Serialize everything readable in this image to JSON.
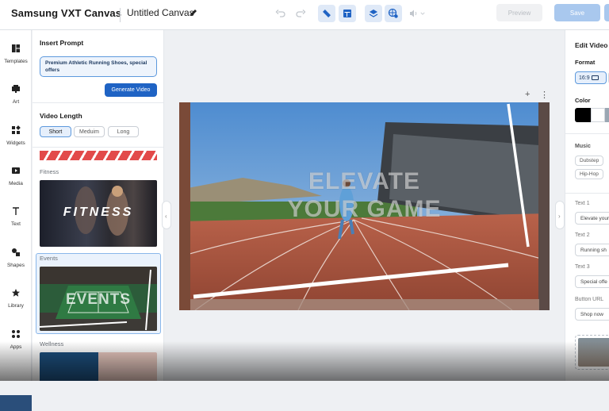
{
  "header": {
    "app_title": "Samsung VXT Canvas",
    "doc_title": "Untitled Canvas",
    "preview_label": "Preview",
    "save_label": "Save"
  },
  "rail": {
    "items": [
      {
        "label": "Templates",
        "icon": "templates-icon"
      },
      {
        "label": "Art",
        "icon": "art-icon"
      },
      {
        "label": "Widgets",
        "icon": "widgets-icon"
      },
      {
        "label": "Media",
        "icon": "media-icon"
      },
      {
        "label": "Text",
        "icon": "text-icon"
      },
      {
        "label": "Shapes",
        "icon": "shapes-icon"
      },
      {
        "label": "Library",
        "icon": "library-icon"
      },
      {
        "label": "Apps",
        "icon": "apps-icon"
      }
    ]
  },
  "panel": {
    "insert_prompt_heading": "Insert Prompt",
    "prompt_text": "Premium Athletic Running Shoes, special offers",
    "generate_label": "Generate Video",
    "video_length_heading": "Video Length",
    "length_options": [
      "Short",
      "Meduim",
      "Long"
    ],
    "selected_length": "Short",
    "categories": [
      {
        "label": "Fitness",
        "thumb_text": "FITNESS"
      },
      {
        "label": "Events",
        "thumb_text": "EVENTS"
      },
      {
        "label": "Wellness",
        "thumb_text": ""
      }
    ]
  },
  "canvas": {
    "overlay_line1": "ELEVATE",
    "overlay_line2": "YOUR GAME"
  },
  "right_panel": {
    "title": "Edit Video",
    "format_heading": "Format",
    "format_value": "16:9",
    "color_heading": "Color",
    "colors": [
      "#000000",
      "#ffffff",
      "#9aa7b3"
    ],
    "music_heading": "Music",
    "music_options": [
      "Dubstep",
      "Hip-Hop"
    ],
    "text1_label": "Text 1",
    "text1_value": "Elevate your",
    "text2_label": "Text 2",
    "text2_value": "Running sh",
    "text3_label": "Text 3",
    "text3_value": "Special offe",
    "button_url_label": "Button URL",
    "button_url_value": "Shop now"
  },
  "colors": {
    "accent": "#1f63c4",
    "save_disabled": "#a9c8ee"
  }
}
